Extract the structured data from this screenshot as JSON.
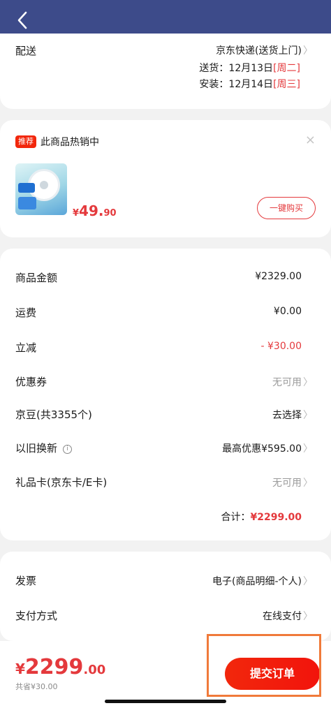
{
  "header": {
    "back_icon": "chevron-left-icon"
  },
  "delivery": {
    "label": "配送",
    "method": "京东快递(送货上门)",
    "ship_label": "送货：",
    "ship_date": "12月13日",
    "ship_day": "周二",
    "install_label": "安装：",
    "install_date": "12月14日",
    "install_day": "周三",
    "bracket_open": "[",
    "bracket_close": "]"
  },
  "recommend": {
    "tag": "推荐",
    "title": "此商品热销中",
    "close": "×",
    "price_currency": "¥",
    "price_int": "49.",
    "price_dec": "90",
    "buy_label": "一键购买"
  },
  "summary": {
    "rows": [
      {
        "label": "商品金额",
        "value": "¥2329.00"
      },
      {
        "label": "运费",
        "value": "¥0.00"
      },
      {
        "label": "立减",
        "value": "- ¥30.00"
      },
      {
        "label": "优惠券",
        "value": "无可用"
      },
      {
        "label": "京豆(共3355个)",
        "value": "去选择"
      },
      {
        "label": "以旧换新",
        "value": "最高优惠¥595.00"
      },
      {
        "label": "礼品卡(京东卡/E卡)",
        "value": "无可用"
      }
    ],
    "info_glyph": "i",
    "total_label": "合计：",
    "total_value": "¥2299.00"
  },
  "extra": {
    "rows": [
      {
        "label": "发票",
        "value": "电子(商品明细-个人)"
      },
      {
        "label": "支付方式",
        "value": "在线支付"
      }
    ]
  },
  "arrow_glyph": "〉",
  "footer": {
    "currency": "¥",
    "price_int": "2299",
    "price_dec": ".00",
    "saved": "共省¥30.00",
    "submit_label": "提交订单"
  },
  "colors": {
    "accent": "#e4393c",
    "topbar": "#3d4b8a",
    "highlight": "#f07a3a"
  }
}
